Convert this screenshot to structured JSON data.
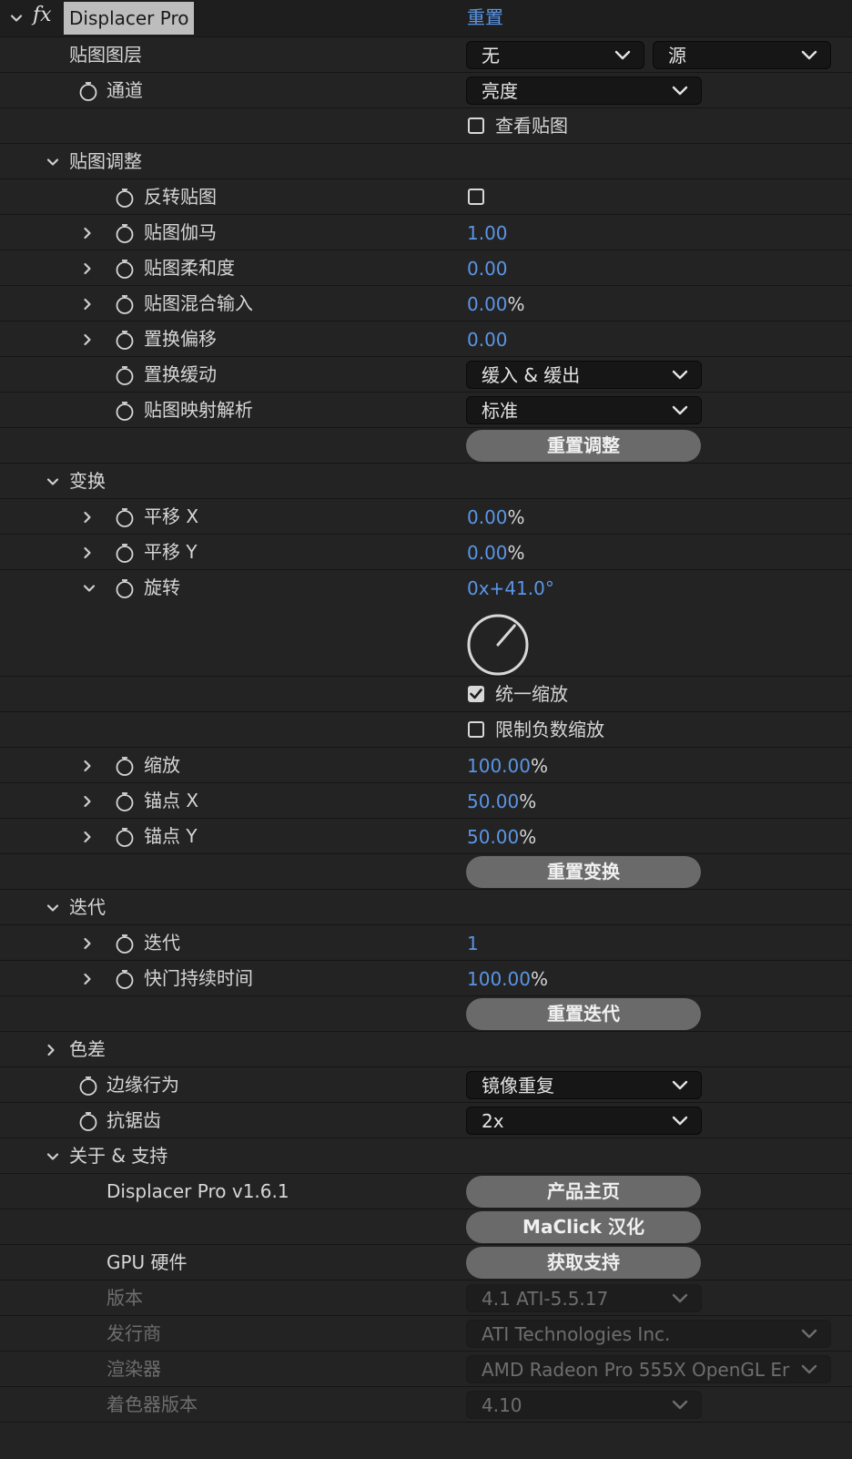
{
  "header": {
    "fx_label": "fx",
    "title": "Displacer Pro",
    "reset_label": "重置"
  },
  "map_layer": {
    "label": "贴图图层",
    "layer_value": "无",
    "source_value": "源"
  },
  "channel": {
    "label": "通道",
    "value": "亮度"
  },
  "view_map": {
    "label": "查看贴图",
    "checked": false
  },
  "map_adjust": {
    "label": "贴图调整",
    "invert": {
      "label": "反转贴图",
      "checked": false
    },
    "gamma": {
      "label": "贴图伽马",
      "value": "1.00"
    },
    "softness": {
      "label": "贴图柔和度",
      "value": "0.00"
    },
    "blend": {
      "label": "贴图混合输入",
      "value": "0.00",
      "unit": "%"
    },
    "offset": {
      "label": "置换偏移",
      "value": "0.00"
    },
    "easing": {
      "label": "置换缓动",
      "value": "缓入 & 缓出"
    },
    "resolution": {
      "label": "贴图映射解析",
      "value": "标准"
    },
    "reset_label": "重置调整"
  },
  "transform": {
    "label": "变换",
    "translate_x": {
      "label": "平移 X",
      "value": "0.00",
      "unit": "%"
    },
    "translate_y": {
      "label": "平移 Y",
      "value": "0.00",
      "unit": "%"
    },
    "rotation": {
      "label": "旋转",
      "value": "0x+41.0°",
      "degrees": 41
    },
    "uniform_scale": {
      "label": "统一缩放",
      "checked": true
    },
    "limit_negative": {
      "label": "限制负数缩放",
      "checked": false
    },
    "scale": {
      "label": "缩放",
      "value": "100.00",
      "unit": "%"
    },
    "anchor_x": {
      "label": "锚点 X",
      "value": "50.00",
      "unit": "%"
    },
    "anchor_y": {
      "label": "锚点 Y",
      "value": "50.00",
      "unit": "%"
    },
    "reset_label": "重置变换"
  },
  "iteration": {
    "label": "迭代",
    "iterations": {
      "label": "迭代",
      "value": "1"
    },
    "shutter": {
      "label": "快门持续时间",
      "value": "100.00",
      "unit": "%"
    },
    "reset_label": "重置迭代"
  },
  "chromatic": {
    "label": "色差"
  },
  "edge": {
    "label": "边缘行为",
    "value": "镜像重复"
  },
  "antialias": {
    "label": "抗锯齿",
    "value": "2x"
  },
  "about": {
    "label": "关于 & 支持",
    "version_label": "Displacer Pro v1.6.1",
    "homepage_label": "产品主页",
    "maclick_label": "MaClick 汉化",
    "gpu_label": "GPU 硬件",
    "support_label": "获取支持",
    "gl_version": {
      "label": "版本",
      "value": "4.1 ATI-5.5.17"
    },
    "vendor": {
      "label": "发行商",
      "value": "ATI Technologies Inc."
    },
    "renderer": {
      "label": "渲染器",
      "value": "AMD Radeon Pro 555X OpenGL Er"
    },
    "shader": {
      "label": "着色器版本",
      "value": "4.10"
    }
  },
  "colors": {
    "accent_blue": "#5b95e6",
    "background": "#232323",
    "button": "#6a6a6a"
  }
}
